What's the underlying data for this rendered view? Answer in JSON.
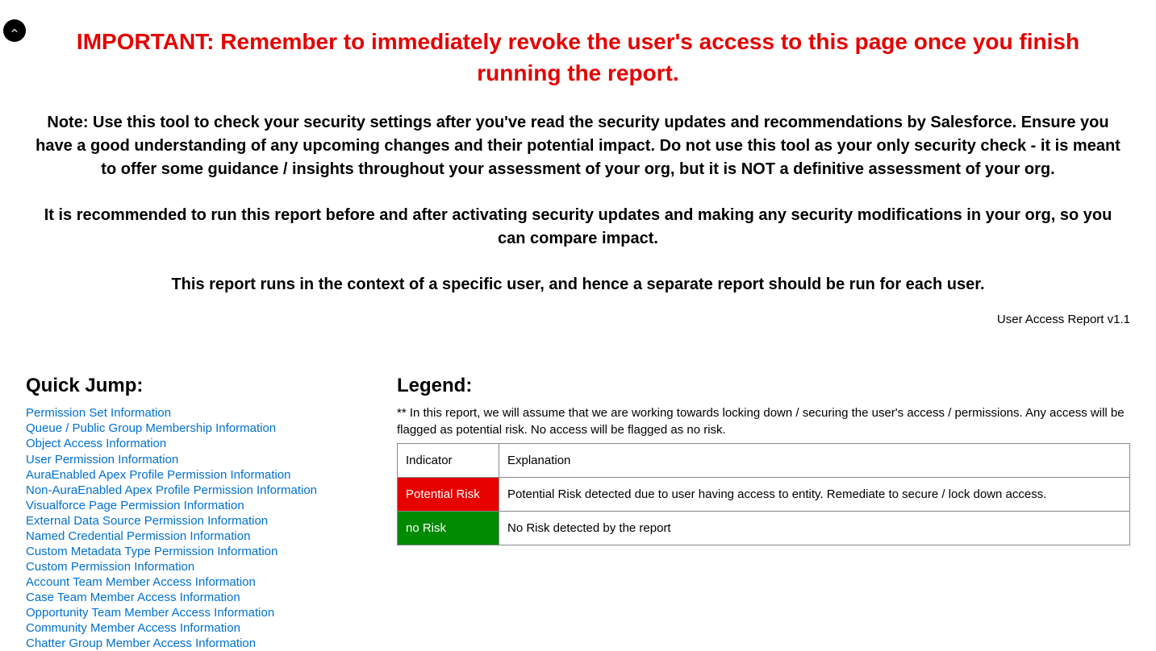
{
  "header": {
    "important": "IMPORTANT: Remember to immediately revoke the user's access to this page once you finish running the report.",
    "note": "Note: Use this tool to check your security settings after you've read the security updates and recommendations by Salesforce. Ensure you have a good understanding of any upcoming changes and their potential impact. Do not use this tool as your only security check - it is meant to offer some guidance / insights throughout your assessment of your org, but it is NOT a definitive assessment of your org.",
    "recommend": "It is recommended to run this report before and after activating security updates and making any security modifications in your org, so you can compare impact.",
    "context": "This report runs in the context of a specific user, and hence a separate report should be run for each user.",
    "version": "User Access Report v1.1"
  },
  "quickJump": {
    "heading": "Quick Jump:",
    "items": [
      "Permission Set Information",
      "Queue / Public Group Membership Information",
      "Object Access Information",
      "User Permission Information",
      "AuraEnabled Apex Profile Permission Information",
      "Non-AuraEnabled Apex Profile Permission Information",
      "Visualforce Page Permission Information",
      "External Data Source Permission Information",
      "Named Credential Permission Information",
      "Custom Metadata Type Permission Information",
      "Custom Permission Information",
      "Account Team Member Access Information",
      "Case Team Member Access Information",
      "Opportunity Team Member Access Information",
      "Community Member Access Information",
      "Chatter Group Member Access Information"
    ]
  },
  "legend": {
    "heading": "Legend:",
    "note": "** In this report, we will assume that we are working towards locking down / securing the user's access / permissions. Any access will be flagged as potential risk. No access will be flagged as no risk.",
    "headerIndicator": "Indicator",
    "headerExplanation": "Explanation",
    "rows": [
      {
        "indicator": "Potential Risk",
        "explanation": "Potential Risk detected due to user having access to entity. Remediate to secure / lock down access."
      },
      {
        "indicator": "no Risk",
        "explanation": "No Risk detected by the report"
      }
    ]
  }
}
